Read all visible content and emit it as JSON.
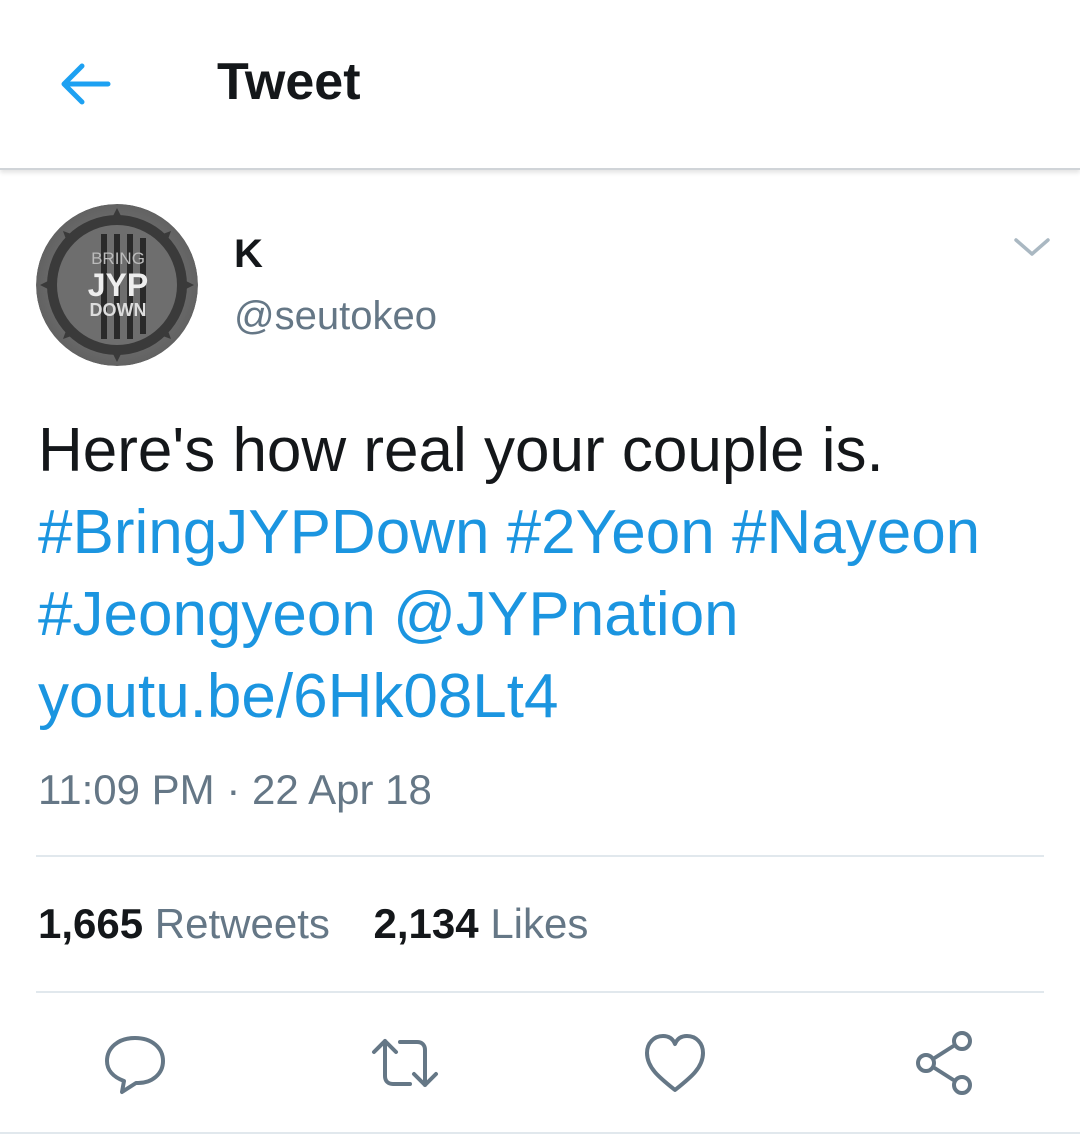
{
  "header": {
    "title": "Tweet",
    "back_icon": "arrow-left-icon",
    "accent_color": "#1da1f2"
  },
  "tweet": {
    "author": {
      "name": "K",
      "handle": "@seutokeo",
      "avatar_lines": [
        "BRING",
        "JYP",
        "DOWN"
      ]
    },
    "text": "Here's how real your couple is.",
    "hashtags": [
      "#BringJYPDown",
      "#2Yeon",
      "#Nayeon",
      "#Jeongyeon"
    ],
    "mention": "@JYPnation",
    "link": "youtu.be/6Hk08Lt4",
    "time": "11:09 PM",
    "separator": "·",
    "date": "22 Apr 18",
    "stats": {
      "retweets_count": "1,665",
      "retweets_label": "Retweets",
      "likes_count": "2,134",
      "likes_label": "Likes"
    },
    "actions": [
      "reply-icon",
      "retweet-icon",
      "like-icon",
      "share-icon"
    ],
    "link_color": "#1b95e0",
    "muted_color": "#657786"
  }
}
